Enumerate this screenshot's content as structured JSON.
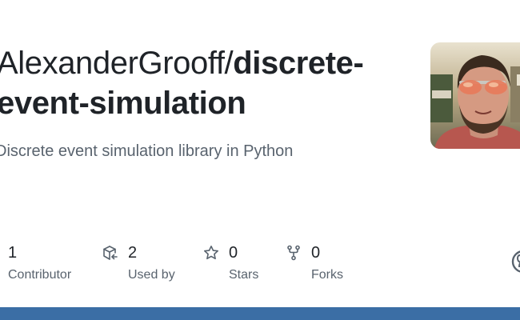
{
  "repo": {
    "owner_prefix": "AlexanderGrooff/",
    "name_part1": "discrete-",
    "name_part2": "event-simulation",
    "description": "Discrete event simulation library in Python"
  },
  "stats": {
    "contributors": {
      "value": "1",
      "label": "Contributor",
      "icon": "people-icon"
    },
    "used_by": {
      "value": "2",
      "label": "Used by",
      "icon": "package-dependents-icon"
    },
    "stars": {
      "value": "0",
      "label": "Stars",
      "icon": "star-icon"
    },
    "forks": {
      "value": "0",
      "label": "Forks",
      "icon": "repo-forked-icon"
    }
  },
  "avatar": {
    "icon": "owner-avatar"
  },
  "branding": {
    "icon": "github-mark-icon"
  },
  "colors": {
    "title": "#1f2328",
    "muted": "#59636e",
    "icon": "#59636e",
    "bottom_bar": "#3b6ea5"
  }
}
